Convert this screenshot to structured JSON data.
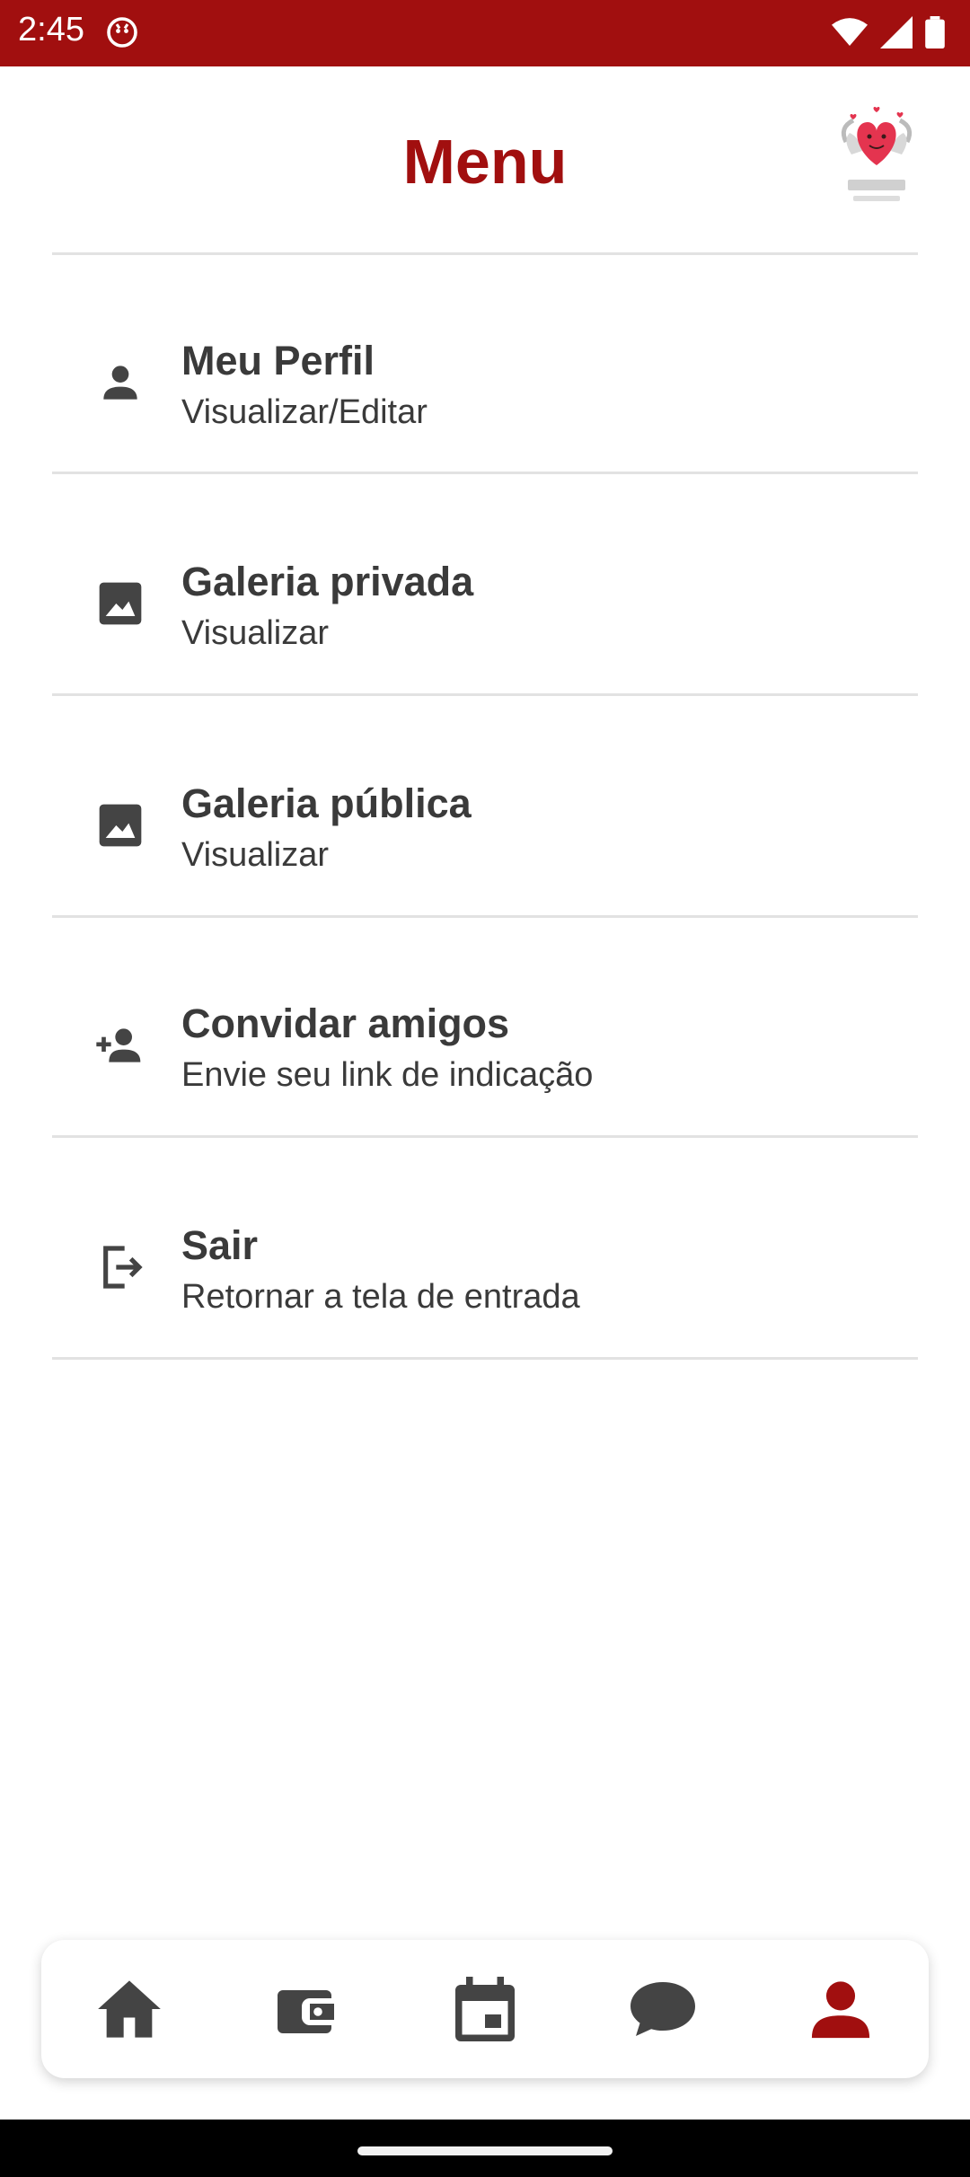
{
  "status_bar": {
    "time": "2:45"
  },
  "header": {
    "title": "Menu"
  },
  "menu": {
    "items": [
      {
        "title": "Meu Perfil",
        "subtitle": "Visualizar/Editar",
        "icon": "person-icon"
      },
      {
        "title": "Galeria privada",
        "subtitle": "Visualizar",
        "icon": "image-icon"
      },
      {
        "title": "Galeria pública",
        "subtitle": "Visualizar",
        "icon": "image-icon"
      },
      {
        "title": "Convidar amigos",
        "subtitle": "Envie seu link de indicação",
        "icon": "person-add-icon"
      },
      {
        "title": "Sair",
        "subtitle": "Retornar a tela de entrada",
        "icon": "logout-icon"
      }
    ]
  },
  "bottom_nav": {
    "items": [
      {
        "icon": "home-icon",
        "active": false
      },
      {
        "icon": "wallet-icon",
        "active": false
      },
      {
        "icon": "calendar-icon",
        "active": false
      },
      {
        "icon": "chat-icon",
        "active": false
      },
      {
        "icon": "profile-icon",
        "active": true
      }
    ]
  },
  "colors": {
    "brand": "#a10f0f",
    "text": "#3a3a3a",
    "icon": "#444444",
    "divider": "#e2e2e2"
  }
}
